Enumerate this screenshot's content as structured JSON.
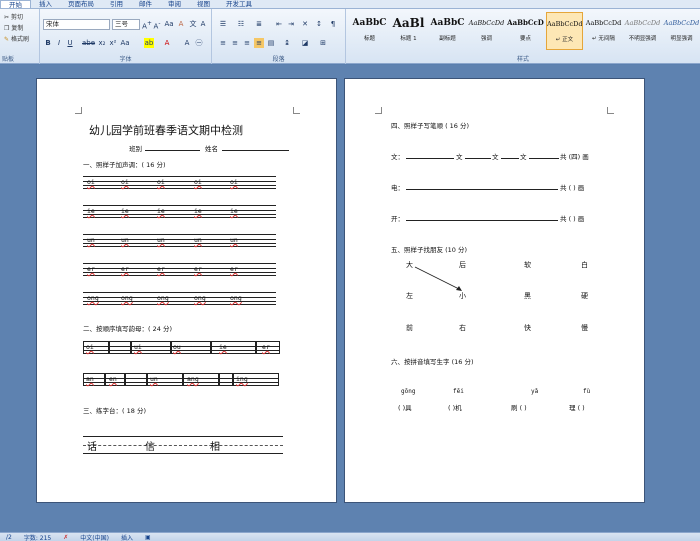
{
  "ribbon": {
    "tabs": [
      "开始",
      "插入",
      "页面布局",
      "引用",
      "邮件",
      "审阅",
      "视图",
      "开发工具"
    ],
    "clipboard": {
      "cut": "剪切",
      "copy": "复制",
      "format_painter": "格式刷",
      "label": "贴板"
    },
    "font": {
      "name": "宋体",
      "size": "三号",
      "label": "字体"
    },
    "paragraph": {
      "label": "段落"
    },
    "styles": {
      "label": "样式",
      "items": [
        {
          "sample": "AaBbC",
          "name": "标题"
        },
        {
          "sample": "AaBl",
          "name": "标题 1"
        },
        {
          "sample": "AaBbC",
          "name": "副标题"
        },
        {
          "sample": "AaBbCcDd",
          "name": "强调"
        },
        {
          "sample": "AaBbCcD",
          "name": "要点"
        },
        {
          "sample": "AaBbCcDd",
          "name": "↵ 正文"
        },
        {
          "sample": "AaBbCcDd",
          "name": "↵ 无间隔"
        },
        {
          "sample": "AaBbCcDd",
          "name": "不明显强调"
        },
        {
          "sample": "AaBbCcDd",
          "name": "明显强调"
        }
      ]
    }
  },
  "page1": {
    "title": "幼儿园学前班春季语文期中检测",
    "class_label": "班别",
    "name_label": "姓名",
    "s1": "一、照样子加声调：( 16 分)",
    "s1_rows": [
      [
        "oi",
        "oi",
        "oi",
        "oi",
        "oi"
      ],
      [
        "ie",
        "ie",
        "ie",
        "ie",
        "ie"
      ],
      [
        "un",
        "un",
        "un",
        "un",
        "un"
      ],
      [
        "er",
        "er",
        "er",
        "er",
        "er"
      ],
      [
        "ong",
        "ong",
        "ong",
        "ong",
        "ong"
      ]
    ],
    "s2": "二、按顺序填写韵母：( 24 分)",
    "s2_row1": [
      "oi",
      "ui",
      "ou",
      "ie",
      "er"
    ],
    "s2_row2": [
      "an",
      "en",
      "un",
      "ang",
      "ing"
    ],
    "s3": "三、练字台：( 18 分)",
    "s3_chars": [
      "话",
      "信",
      "相"
    ]
  },
  "page2": {
    "s4": "四、照样子写笔顺 ( 16 分)",
    "s4_rows": [
      {
        "char": "文：",
        "parts": [
          "文",
          "文",
          "文"
        ],
        "end": "共 (四) 画"
      },
      {
        "char": "电：",
        "end": "共 (  ) 画"
      },
      {
        "char": "开：",
        "end": "共 (  ) 画"
      }
    ],
    "s5": "五、照样子找朋友 (10 分)",
    "s5_rows": [
      [
        "大",
        "后",
        "软",
        "白"
      ],
      [
        "左",
        "小",
        "黑",
        "硬"
      ],
      [
        "前",
        "右",
        "快",
        "慢"
      ]
    ],
    "s6": "六、按拼音填写生字 (16 分)",
    "s6_pinyin": [
      "gōng",
      "fēi",
      "yǎ",
      "fù"
    ],
    "s6_fill": [
      "(    )具",
      "(    )机",
      "刷 (    )",
      "理 (    )"
    ]
  },
  "status": {
    "page": "/2",
    "words": "字数: 215",
    "language": "中文(中国)",
    "mode": "插入"
  }
}
